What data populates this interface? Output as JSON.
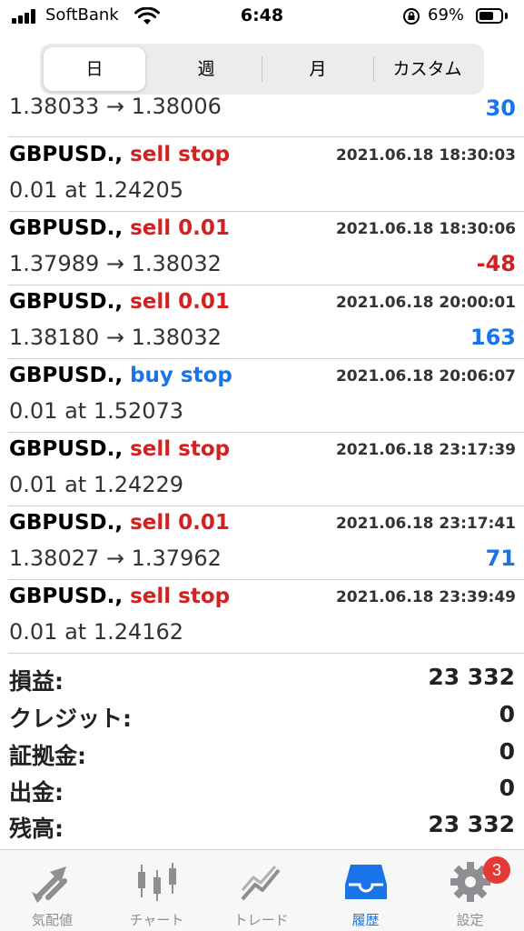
{
  "status": {
    "carrier": "SoftBank",
    "time": "6:48",
    "battery": "69%",
    "battery_level": 0.69
  },
  "segments": [
    {
      "label": "日",
      "active": true
    },
    {
      "label": "週",
      "active": false
    },
    {
      "label": "月",
      "active": false
    },
    {
      "label": "カスタム",
      "active": false
    }
  ],
  "partial_row": {
    "price": "1.38033 → 1.38006",
    "profit": "30"
  },
  "orders": [
    {
      "symbol": "GBPUSD.,",
      "action": "sell stop",
      "time": "2021.06.18 18:30:03",
      "price": "0.01 at 1.24205",
      "profit": ""
    },
    {
      "symbol": "GBPUSD.,",
      "action": "sell 0.01",
      "time": "2021.06.18 18:30:06",
      "price": "1.37989 → 1.38032",
      "profit": "-48"
    },
    {
      "symbol": "GBPUSD.,",
      "action": "sell 0.01",
      "time": "2021.06.18 20:00:01",
      "price": "1.38180 → 1.38032",
      "profit": "163"
    },
    {
      "symbol": "GBPUSD.,",
      "action": "buy stop",
      "time": "2021.06.18 20:06:07",
      "price": "0.01 at 1.52073",
      "profit": ""
    },
    {
      "symbol": "GBPUSD.,",
      "action": "sell stop",
      "time": "2021.06.18 23:17:39",
      "price": "0.01 at 1.24229",
      "profit": ""
    },
    {
      "symbol": "GBPUSD.,",
      "action": "sell 0.01",
      "time": "2021.06.18 23:17:41",
      "price": "1.38027 → 1.37962",
      "profit": "71"
    },
    {
      "symbol": "GBPUSD.,",
      "action": "sell stop",
      "time": "2021.06.18 23:39:49",
      "price": "0.01 at 1.24162",
      "profit": ""
    }
  ],
  "summary": [
    {
      "label": "損益:",
      "value": "23 332"
    },
    {
      "label": "クレジット:",
      "value": "0"
    },
    {
      "label": "証拠金:",
      "value": "0"
    },
    {
      "label": "出金:",
      "value": "0"
    },
    {
      "label": "残高:",
      "value": "23 332"
    }
  ],
  "tabs": [
    {
      "label": "気配値",
      "icon": "quotes-arrows-icon",
      "active": false
    },
    {
      "label": "チャート",
      "icon": "candlestick-chart-icon",
      "active": false
    },
    {
      "label": "トレード",
      "icon": "trade-line-icon",
      "active": false
    },
    {
      "label": "履歴",
      "icon": "history-inbox-icon",
      "active": true
    },
    {
      "label": "設定",
      "icon": "gear-icon",
      "active": false
    }
  ],
  "settings_badge": "3",
  "colors": {
    "sell": "#d32121",
    "buy": "#1a73e8",
    "profit_positive": "#1a73e8",
    "profit_negative": "#d32121",
    "tab_active": "#1a73e8",
    "tab_inactive": "#8e8e93",
    "badge": "#e53935"
  }
}
